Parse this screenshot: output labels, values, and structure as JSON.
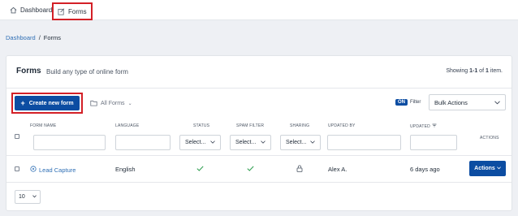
{
  "topnav": {
    "dashboard_label": "Dashboard",
    "forms_label": "Forms"
  },
  "breadcrumb": {
    "root": "Dashboard",
    "separator": "/",
    "current": "Forms"
  },
  "card": {
    "title": "Forms",
    "subtitle": "Build any type of online form",
    "showing_prefix": "Showing ",
    "showing_range": "1-1",
    "showing_of": " of ",
    "showing_total": "1",
    "showing_suffix": " item."
  },
  "toolbar": {
    "create_label": "Create new form",
    "all_forms_label": "All Forms",
    "filter_on": "ON",
    "filter_label": "Filter",
    "bulk_actions_label": "Bulk Actions"
  },
  "columns": {
    "form_name": "FORM NAME",
    "language": "LANGUAGE",
    "status": "STATUS",
    "spam_filter": "SPAM FILTER",
    "sharing": "SHARING",
    "updated_by": "UPDATED BY",
    "updated": "UPDATED",
    "actions": "ACTIONS"
  },
  "filters": {
    "status_select": "Select...",
    "spam_select": "Select...",
    "sharing_select": "Select..."
  },
  "rows": [
    {
      "form_name": "Lead Capture",
      "language": "English",
      "status": "active",
      "spam_filter": "active",
      "sharing": "locked",
      "updated_by": "Alex A.",
      "updated": "6 days ago",
      "actions_label": "Actions"
    }
  ],
  "pagination": {
    "page_size": "10"
  },
  "colors": {
    "primary": "#0c4da2",
    "link": "#2f6fb5",
    "success": "#2e9e4f",
    "highlight": "#d32027"
  }
}
